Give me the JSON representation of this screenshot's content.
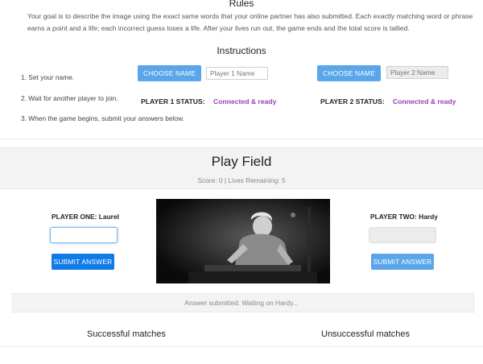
{
  "rules": {
    "title": "Rules",
    "text": "Your goal is to describe the image using the exact same words that your online partner has also submitted. Each exactly matching word or phrase earns a point and a life; each incorrect guess loses a life. After your lives run out, the game ends and the total score is tallied."
  },
  "instructions": {
    "title": "Instructions",
    "steps": [
      "1. Set your name.",
      "2. Wait for another player to join.",
      "3. When the game begins, submit your answers below."
    ]
  },
  "player1": {
    "choose_label": "CHOOSE NAME",
    "name_placeholder": "Player 1 Name",
    "status_label": "PLAYER 1 STATUS:",
    "status_value": "Connected & ready"
  },
  "player2": {
    "choose_label": "CHOOSE NAME",
    "name_placeholder": "Player 2 Name",
    "status_label": "PLAYER 2 STATUS:",
    "status_value": "Connected & ready"
  },
  "play_field": {
    "title": "Play Field",
    "score_text": "Score: 0 | Lives Remaining: 5",
    "player_one_label": "PLAYER ONE: Laurel",
    "player_two_label": "PLAYER TWO: Hardy",
    "submit_label_one": "SUBMIT ANSWER",
    "submit_label_two": "SUBMIT ANSWER",
    "waiting_text": "Answer submitted. Waiting on Hardy..."
  },
  "results": {
    "successful_title": "Successful matches",
    "unsuccessful_title": "Unsuccessful matches"
  },
  "colors": {
    "primary_button": "#0f7be8",
    "light_button": "#5aa6ea",
    "status_purple": "#9b3fb6"
  }
}
